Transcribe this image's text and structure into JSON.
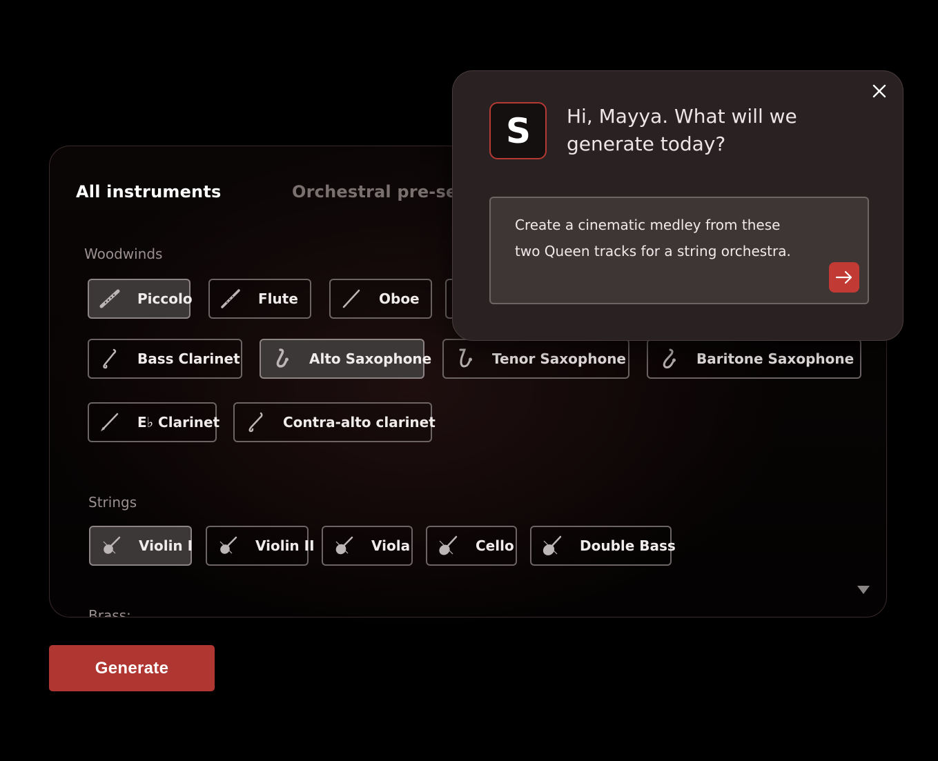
{
  "tabs": {
    "all_instruments": "All instruments",
    "orchestral_presets": "Orchestral pre-se"
  },
  "sections": {
    "woodwinds": "Woodwinds",
    "strings": "Strings",
    "brass": "Brass:"
  },
  "woodwinds": [
    {
      "label": "Piccolo",
      "selected": true,
      "icon": "piccolo-icon"
    },
    {
      "label": "Flute",
      "selected": false,
      "icon": "flute-icon"
    },
    {
      "label": "Oboe",
      "selected": false,
      "icon": "oboe-icon"
    },
    {
      "label": "",
      "selected": false,
      "icon": "hidden-chip"
    },
    {
      "label": "Bass Clarinet",
      "selected": false,
      "icon": "bass-clarinet-icon"
    },
    {
      "label": "Alto Saxophone",
      "selected": true,
      "icon": "saxophone-icon"
    },
    {
      "label": "Tenor Saxophone",
      "selected": false,
      "icon": "saxophone-icon"
    },
    {
      "label": "Baritone Saxophone",
      "selected": false,
      "icon": "baritone-saxophone-icon"
    },
    {
      "label": "E♭ Clarinet",
      "selected": false,
      "icon": "clarinet-icon"
    },
    {
      "label": "Contra-alto clarinet",
      "selected": false,
      "icon": "contra-alto-clarinet-icon"
    }
  ],
  "strings": [
    {
      "label": "Violin I",
      "selected": true,
      "icon": "violin-icon"
    },
    {
      "label": "Violin II",
      "selected": false,
      "icon": "violin-icon"
    },
    {
      "label": "Viola",
      "selected": false,
      "icon": "viola-icon"
    },
    {
      "label": "Cello",
      "selected": false,
      "icon": "cello-icon"
    },
    {
      "label": "Double Bass",
      "selected": false,
      "icon": "double-bass-icon"
    }
  ],
  "generate_label": "Generate",
  "assistant": {
    "logo_letter": "S",
    "greeting": "Hi, Mayya. What will we generate today?",
    "prompt": "Create a cinematic medley from these two Queen tracks for a string orchestra."
  },
  "colors": {
    "accent": "#b03631",
    "background": "#000000",
    "popup_bg": "#2a2222",
    "chip_border": "#6d6565",
    "chip_selected_bg": "#3d3838"
  }
}
